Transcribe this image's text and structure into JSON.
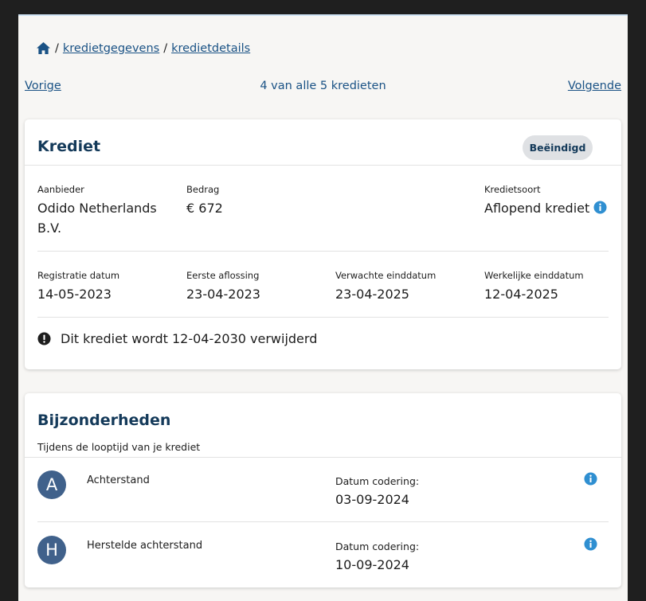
{
  "breadcrumb": {
    "home_icon": "home-icon",
    "items": [
      "kredietgegevens",
      "kredietdetails"
    ],
    "separator": "/"
  },
  "pager": {
    "previous": "Vorige",
    "count": "4 van alle 5 kredieten",
    "next": "Volgende"
  },
  "credit": {
    "title": "Krediet",
    "status": "Beëindigd",
    "fields": {
      "provider": {
        "label": "Aanbieder",
        "value_line1": "Odido Netherlands",
        "value_line2": "B.V."
      },
      "amount": {
        "label": "Bedrag",
        "value": "€ 672"
      },
      "type": {
        "label": "Kredietsoort",
        "value": "Aflopend krediet"
      },
      "registration": {
        "label": "Registratie datum",
        "value": "14-05-2023"
      },
      "first_payment": {
        "label": "Eerste aflossing",
        "value": "23-04-2023"
      },
      "expected_end": {
        "label": "Verwachte einddatum",
        "value": "23-04-2025"
      },
      "actual_end": {
        "label": "Werkelijke einddatum",
        "value": "12-04-2025"
      }
    },
    "notice": "Dit krediet wordt 12-04-2030 verwijderd"
  },
  "particulars": {
    "title": "Bijzonderheden",
    "subtitle": "Tijdens de looptijd van je krediet",
    "rows": [
      {
        "code": "A",
        "label": "Achterstand",
        "date_label": "Datum codering:",
        "date": "03-09-2024"
      },
      {
        "code": "H",
        "label": "Herstelde achterstand",
        "date_label": "Datum codering:",
        "date": "10-09-2024"
      }
    ]
  },
  "colors": {
    "link": "#1a5285",
    "title": "#143a5a",
    "avatar": "#40618b",
    "info": "#2f8fd1",
    "badge_bg": "#dfe1e4"
  }
}
